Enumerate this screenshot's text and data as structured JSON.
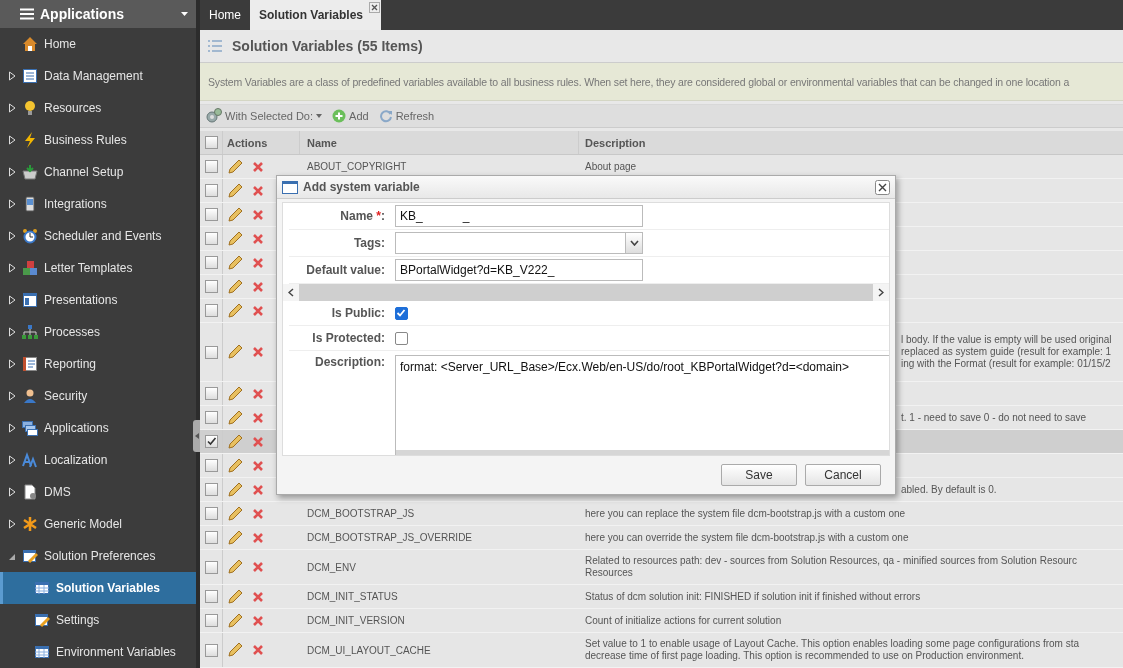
{
  "sidebar": {
    "title": "Applications",
    "items": [
      {
        "label": "Home",
        "kind": "leaf"
      },
      {
        "label": "Data Management",
        "kind": "folder",
        "expanded": false
      },
      {
        "label": "Resources",
        "kind": "folder",
        "expanded": false
      },
      {
        "label": "Business Rules",
        "kind": "folder",
        "expanded": false
      },
      {
        "label": "Channel Setup",
        "kind": "folder",
        "expanded": false
      },
      {
        "label": "Integrations",
        "kind": "folder",
        "expanded": false
      },
      {
        "label": "Scheduler and Events",
        "kind": "folder",
        "expanded": false
      },
      {
        "label": "Letter Templates",
        "kind": "folder",
        "expanded": false
      },
      {
        "label": "Presentations",
        "kind": "folder",
        "expanded": false
      },
      {
        "label": "Processes",
        "kind": "folder",
        "expanded": false
      },
      {
        "label": "Reporting",
        "kind": "folder",
        "expanded": false
      },
      {
        "label": "Security",
        "kind": "folder",
        "expanded": false
      },
      {
        "label": "Applications",
        "kind": "folder",
        "expanded": false
      },
      {
        "label": "Localization",
        "kind": "folder",
        "expanded": false
      },
      {
        "label": "DMS",
        "kind": "folder",
        "expanded": false
      },
      {
        "label": "Generic Model",
        "kind": "folder",
        "expanded": false
      },
      {
        "label": "Solution Preferences",
        "kind": "folder",
        "expanded": true,
        "children": [
          {
            "label": "Solution Variables",
            "selected": true
          },
          {
            "label": "Settings",
            "selected": false
          },
          {
            "label": "Environment Variables",
            "selected": false
          }
        ]
      }
    ]
  },
  "tabs": [
    {
      "label": "Home",
      "selected": false,
      "closable": false
    },
    {
      "label": "Solution Variables",
      "selected": true,
      "closable": true
    }
  ],
  "page": {
    "title": "Solution Variables (55 Items)",
    "info": "System Variables are a class of predefined variables available to all business rules. When set here, they are considered global or environmental variables that can be changed in one location a"
  },
  "toolbar": [
    {
      "kind": "menu",
      "label": "With Selected Do:"
    },
    {
      "kind": "add",
      "label": "Add"
    },
    {
      "kind": "refresh",
      "label": "Refresh"
    }
  ],
  "table": {
    "all_checked": false,
    "columns": [
      "Actions",
      "Name",
      "Description"
    ],
    "rows": [
      {
        "checked": false,
        "name": "ABOUT_COPYRIGHT",
        "description": [
          "About page"
        ]
      },
      {
        "checked": false
      },
      {
        "checked": false
      },
      {
        "checked": false
      },
      {
        "checked": false
      },
      {
        "checked": false
      },
      {
        "checked": false
      },
      {
        "checked": false,
        "description": [
          "l body. If the value is empty will be used original",
          "replaced as system guide (result for example: 1",
          "ing with the Format (result for example: 01/15/2"
        ]
      },
      {
        "checked": false
      },
      {
        "checked": false,
        "description": [
          "t. 1 - need to save 0 - do not need to save"
        ]
      },
      {
        "checked": true
      },
      {
        "checked": false
      },
      {
        "checked": false,
        "description": [
          "abled. By default is 0."
        ]
      },
      {
        "checked": false,
        "name": "DCM_BOOTSTRAP_JS",
        "description": [
          "here you can replace the system file dcm-bootstrap.js with a custom one"
        ]
      },
      {
        "checked": false,
        "name": "DCM_BOOTSTRAP_JS_OVERRIDE",
        "description": [
          "here you can override the system file dcm-bootstrap.js with a custom one"
        ]
      },
      {
        "checked": false,
        "name": "DCM_ENV",
        "description": [
          "Related to resources path: dev - sources from Solution Resources, qa - minified sources from Solution Resourc",
          "Resources"
        ]
      },
      {
        "checked": false,
        "name": "DCM_INIT_STATUS",
        "description": [
          "Status of dcm solution init: FINISHED if solution init if finished without errors"
        ]
      },
      {
        "checked": false,
        "name": "DCM_INIT_VERSION",
        "description": [
          "Count of initialize actions for current solution"
        ]
      },
      {
        "checked": false,
        "name": "DCM_UI_LAYOUT_CACHE",
        "description": [
          "Set value to 1 to enable usage of Layout Cache. This option enables loading some page configurations from sta",
          "decrease time of first page loading. This option is recommended to use on Production environment."
        ]
      }
    ]
  },
  "dialog": {
    "title": "Add system variable",
    "fields": [
      {
        "kind": "text",
        "label": "Name ",
        "mark": "*",
        "label_end": ":",
        "value": "KB_            _"
      },
      {
        "kind": "select",
        "label": "Tags:"
      },
      {
        "kind": "text",
        "label": "Default value:",
        "value": "BPortalWidget?d=KB_V222_"
      },
      {
        "kind": "scrollbar"
      },
      {
        "kind": "checkbox",
        "label": "Is Public:",
        "checked": true
      },
      {
        "kind": "checkbox",
        "label": "Is Protected:",
        "checked": false
      },
      {
        "kind": "textarea",
        "label": "Description:",
        "value": "format: <Server_URL_Base>/Ecx.Web/en-US/do/root_KBPortalWidget?d=<domain>"
      }
    ],
    "buttons": [
      "Save",
      "Cancel"
    ]
  }
}
